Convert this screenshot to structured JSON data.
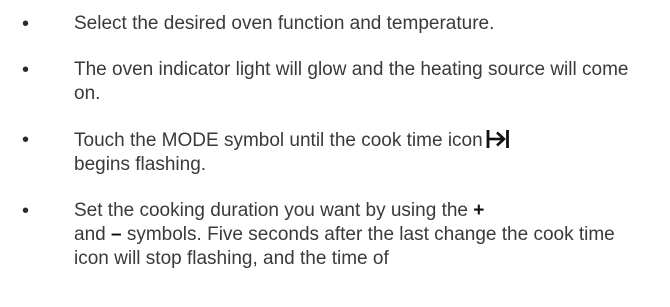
{
  "steps": [
    {
      "text": "Select the desired oven function and temperature."
    },
    {
      "text": "The oven indicator light will glow and the heating source will come on."
    },
    {
      "text_before_icon": "Touch the MODE symbol until the cook time icon",
      "icon": "cook-time-icon",
      "text_after_icon": "begins flashing."
    },
    {
      "text_part1": "Set the cooking duration you want by using the",
      "plus_symbol": "+",
      "text_part2": "and",
      "minus_symbol": "–",
      "text_part3": "symbols. Five seconds after the last change the cook time icon will stop flashing, and the time of"
    }
  ],
  "bullet_glyph": "•"
}
